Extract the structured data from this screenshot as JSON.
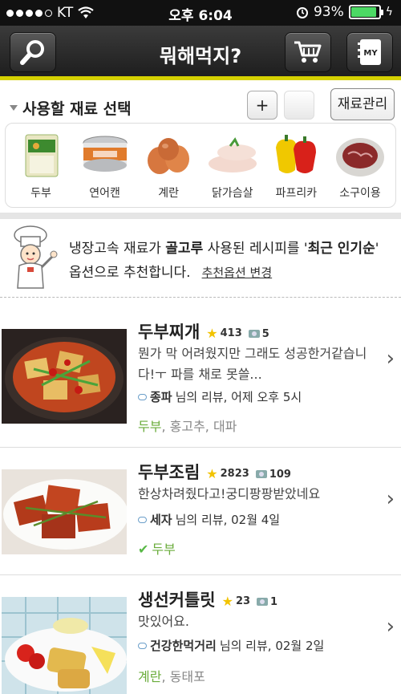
{
  "status_bar": {
    "carrier": "KT",
    "time": "오후 6:04",
    "battery": "93%",
    "battery_level": 0.93
  },
  "nav": {
    "title": "뭐해먹지?",
    "left_icon": "search-icon",
    "cart_icon": "cart-icon",
    "my_label": "MY"
  },
  "ingredient_section": {
    "title": "사용할 재료 선택",
    "add_label": "+",
    "manage_label": "재료관리",
    "items": [
      {
        "label": "두부",
        "icon": "tofu-icon"
      },
      {
        "label": "연어캔",
        "icon": "salmon-can-icon"
      },
      {
        "label": "계란",
        "icon": "egg-icon"
      },
      {
        "label": "닭가슴살",
        "icon": "chicken-breast-icon"
      },
      {
        "label": "파프리카",
        "icon": "paprika-icon"
      },
      {
        "label": "소구이용",
        "icon": "beef-icon"
      }
    ]
  },
  "notice": {
    "text_1": "냉장고속 재료가 ",
    "highlight_1": "골고루",
    "text_2": " 사용된 레시피를 '",
    "highlight_2": "최근 인기순",
    "text_3": "' 옵션으로 추천합니다.",
    "link": "추천옵션 변경"
  },
  "recipes": [
    {
      "title": "두부찌개",
      "stars": "413",
      "photos": "5",
      "desc": "뭔가 막 어려웠지만 그래도 성공한거같습니다!ㅜ 파를 채로 못쓸...",
      "reviewer": "종파",
      "review_suffix": "님의 리뷰, 어제 오후 5시",
      "tags_green": "두부",
      "tags_rest": ", 홍고추, 대파"
    },
    {
      "title": "두부조림",
      "stars": "2823",
      "photos": "109",
      "desc": "한상차려줬다고!궁디팡팡받았네요",
      "reviewer": "세자",
      "review_suffix": "님의 리뷰, 02월 4일",
      "tags_green": "두부",
      "tags_rest": ""
    },
    {
      "title": "생선커틀릿",
      "stars": "23",
      "photos": "1",
      "desc": "맛있어요.",
      "reviewer": "건강한먹거리",
      "review_suffix": "님의 리뷰, 02월 2일",
      "tags_green": "계란",
      "tags_rest": ", 동태포"
    }
  ],
  "colors": {
    "accent": "#d5d100",
    "green": "#6aac3b",
    "star": "#f2c300"
  }
}
